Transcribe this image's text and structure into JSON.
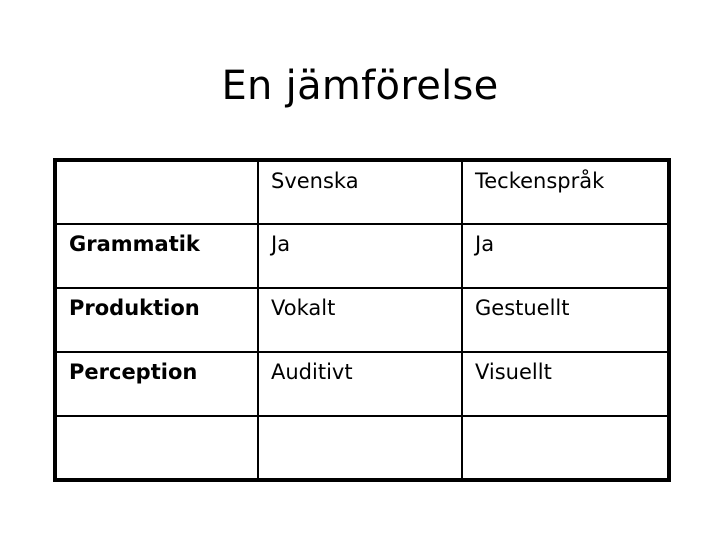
{
  "slide": {
    "title": "En jämförelse",
    "background_color": "#ffffff",
    "text_color": "#000000"
  },
  "table": {
    "border_color": "#000000",
    "header": {
      "corner": "",
      "col2": "Svenska",
      "col3": "Teckenspråk"
    },
    "rows": [
      {
        "label": "Grammatik",
        "svenska": "Ja",
        "teckensprak": "Ja"
      },
      {
        "label": "Produktion",
        "svenska": "Vokalt",
        "teckensprak": "Gestuellt"
      },
      {
        "label": "Perception",
        "svenska": "Auditivt",
        "teckensprak": "Visuellt"
      },
      {
        "label": "",
        "svenska": "",
        "teckensprak": ""
      }
    ]
  }
}
